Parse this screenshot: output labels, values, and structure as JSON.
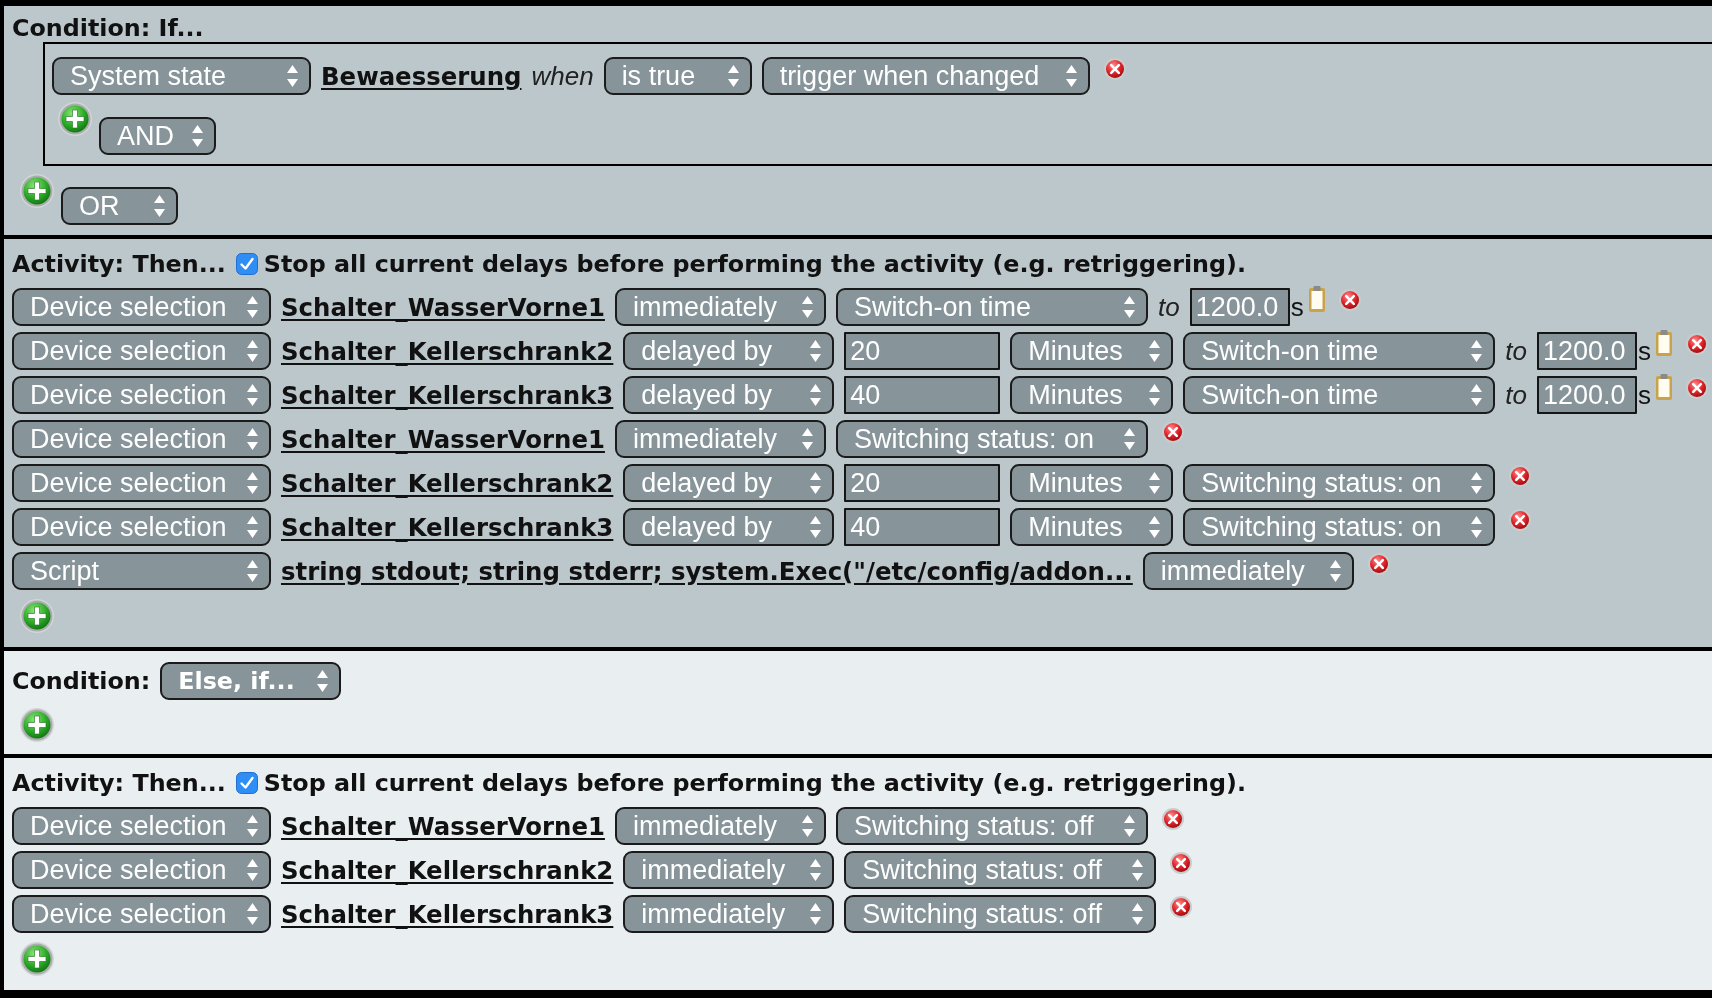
{
  "branches": [
    {
      "condition": {
        "label": "Condition: If...",
        "groups": [
          {
            "rows": [
              {
                "parts": [
                  {
                    "kind": "source",
                    "value": "System state"
                  },
                  {
                    "kind": "link",
                    "text": "Bewaesserung"
                  },
                  {
                    "kind": "word",
                    "text": "when"
                  },
                  {
                    "kind": "state",
                    "value": "is true"
                  },
                  {
                    "kind": "trigger",
                    "value": "trigger when changed"
                  }
                ]
              }
            ],
            "join": "AND"
          }
        ],
        "join": "OR"
      },
      "activity": {
        "label": "Activity: Then...",
        "stop_delays": true,
        "stop_delays_label": "Stop all current delays before performing the activity (e.g. retriggering).",
        "rows": [
          {
            "parts": [
              {
                "kind": "source",
                "value": "Device selection"
              },
              {
                "kind": "link",
                "text": "Schalter_WasserVorne1"
              },
              {
                "kind": "timing",
                "value": "immediately"
              },
              {
                "kind": "parameter",
                "value": "Switch-on time"
              },
              {
                "kind": "limit",
                "word": "to",
                "value": "1200.0",
                "unit": "s"
              }
            ]
          },
          {
            "parts": [
              {
                "kind": "source",
                "value": "Device selection"
              },
              {
                "kind": "link",
                "text": "Schalter_Kellerschrank2"
              },
              {
                "kind": "timing",
                "value": "delayed by"
              },
              {
                "kind": "delay",
                "value": "20"
              },
              {
                "kind": "unit",
                "value": "Minutes"
              },
              {
                "kind": "parameter",
                "value": "Switch-on time"
              },
              {
                "kind": "limit",
                "word": "to",
                "value": "1200.0",
                "unit": "s"
              }
            ]
          },
          {
            "parts": [
              {
                "kind": "source",
                "value": "Device selection"
              },
              {
                "kind": "link",
                "text": "Schalter_Kellerschrank3"
              },
              {
                "kind": "timing",
                "value": "delayed by"
              },
              {
                "kind": "delay",
                "value": "40"
              },
              {
                "kind": "unit",
                "value": "Minutes"
              },
              {
                "kind": "parameter",
                "value": "Switch-on time"
              },
              {
                "kind": "limit",
                "word": "to",
                "value": "1200.0",
                "unit": "s"
              }
            ]
          },
          {
            "parts": [
              {
                "kind": "source",
                "value": "Device selection"
              },
              {
                "kind": "link",
                "text": "Schalter_WasserVorne1"
              },
              {
                "kind": "timing",
                "value": "immediately"
              },
              {
                "kind": "parameter",
                "value": "Switching status: on"
              }
            ]
          },
          {
            "parts": [
              {
                "kind": "source",
                "value": "Device selection"
              },
              {
                "kind": "link",
                "text": "Schalter_Kellerschrank2"
              },
              {
                "kind": "timing",
                "value": "delayed by"
              },
              {
                "kind": "delay",
                "value": "20"
              },
              {
                "kind": "unit",
                "value": "Minutes"
              },
              {
                "kind": "parameter",
                "value": "Switching status: on"
              }
            ]
          },
          {
            "parts": [
              {
                "kind": "source",
                "value": "Device selection"
              },
              {
                "kind": "link",
                "text": "Schalter_Kellerschrank3"
              },
              {
                "kind": "timing",
                "value": "delayed by"
              },
              {
                "kind": "delay",
                "value": "40"
              },
              {
                "kind": "unit",
                "value": "Minutes"
              },
              {
                "kind": "parameter",
                "value": "Switching status: on"
              }
            ]
          },
          {
            "parts": [
              {
                "kind": "source",
                "value": "Script"
              },
              {
                "kind": "script",
                "text": "string stdout; string stderr; system.Exec(\"/etc/config/addon..."
              },
              {
                "kind": "timing",
                "value": "immediately"
              }
            ]
          }
        ]
      }
    },
    {
      "condition": {
        "label": "Condition:",
        "mode": "Else, if..."
      },
      "activity": {
        "label": "Activity: Then...",
        "stop_delays": true,
        "stop_delays_label": "Stop all current delays before performing the activity (e.g. retriggering).",
        "rows": [
          {
            "parts": [
              {
                "kind": "source",
                "value": "Device selection"
              },
              {
                "kind": "link",
                "text": "Schalter_WasserVorne1"
              },
              {
                "kind": "timing",
                "value": "immediately"
              },
              {
                "kind": "parameter",
                "value": "Switching status: off"
              }
            ]
          },
          {
            "parts": [
              {
                "kind": "source",
                "value": "Device selection"
              },
              {
                "kind": "link",
                "text": "Schalter_Kellerschrank2"
              },
              {
                "kind": "timing",
                "value": "immediately"
              },
              {
                "kind": "parameter",
                "value": "Switching status: off"
              }
            ]
          },
          {
            "parts": [
              {
                "kind": "source",
                "value": "Device selection"
              },
              {
                "kind": "link",
                "text": "Schalter_Kellerschrank3"
              },
              {
                "kind": "timing",
                "value": "immediately"
              },
              {
                "kind": "parameter",
                "value": "Switching status: off"
              }
            ]
          }
        ]
      }
    }
  ]
}
